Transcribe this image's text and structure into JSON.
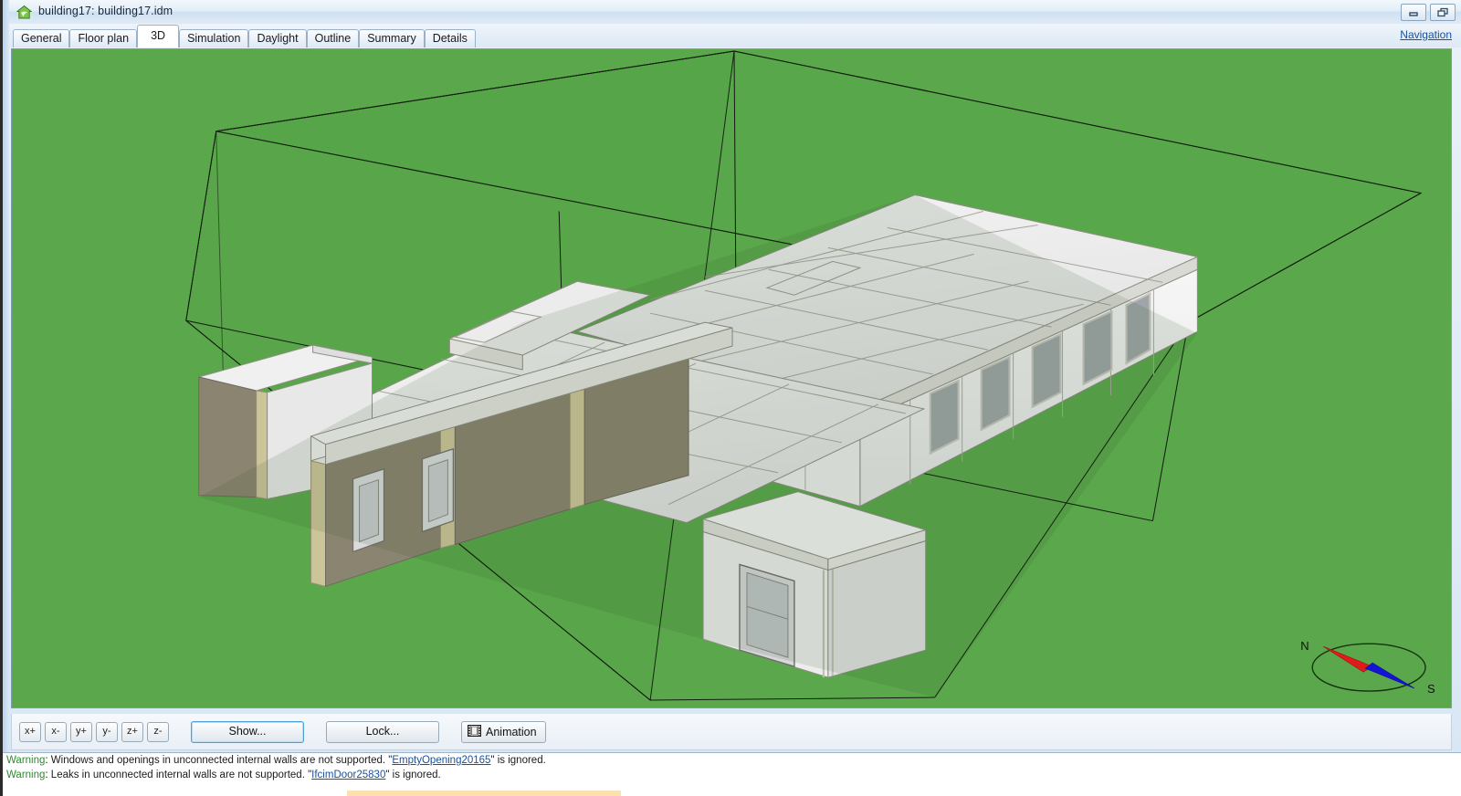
{
  "window": {
    "title": "building17: building17.idm",
    "icon": "house-icon",
    "minimize_label": "Minimize",
    "restore_label": "Restore"
  },
  "tabs": [
    {
      "label": "General",
      "active": false
    },
    {
      "label": "Floor plan",
      "active": false
    },
    {
      "label": "3D",
      "active": true
    },
    {
      "label": "Simulation",
      "active": false
    },
    {
      "label": "Daylight",
      "active": false
    },
    {
      "label": "Outline",
      "active": false
    },
    {
      "label": "Summary",
      "active": false
    },
    {
      "label": "Details",
      "active": false
    }
  ],
  "navigation_link": "Navigation",
  "viewport": {
    "ground_color": "#5ba84c",
    "ground_shaded_color": "#4f9a43",
    "wall_white": "#f0f0f0",
    "wall_dark": "#8b8470",
    "insulation_color": "#cdc59a",
    "roof_color": "#e9e9e9",
    "window_glass": "#b6bcc0",
    "edge_color": "#6e6e62",
    "wireframe_color": "#1a1a1a",
    "compass": {
      "north_label": "N",
      "south_label": "S",
      "north_needle_color": "#e01b1b",
      "south_needle_color": "#1414d4",
      "ring_color": "#14320f"
    }
  },
  "toolbar": {
    "axis_buttons": [
      "x+",
      "x-",
      "y+",
      "y-",
      "z+",
      "z-"
    ],
    "show_label": "Show...",
    "lock_label": "Lock...",
    "animation_label": "Animation",
    "animation_icon": "film-strip-icon"
  },
  "messages": [
    {
      "tag": "Warning",
      "text_before": ": Windows and openings in unconnected internal walls are not supported. \"",
      "object": "EmptyOpening20165",
      "text_after": "\" is ignored."
    },
    {
      "tag": "Warning",
      "text_before": ": Leaks in unconnected internal walls are not supported. \"",
      "object": "IfcimDoor25830",
      "text_after": "\" is ignored."
    }
  ]
}
